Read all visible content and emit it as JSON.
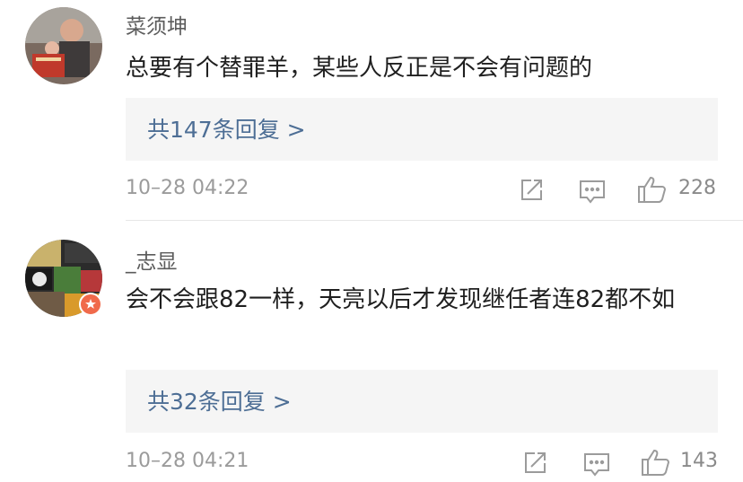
{
  "comments": [
    {
      "username": "菜须坤",
      "text": "总要有个替罪羊，某些人反正是不会有问题的",
      "reply_label": "共147条回复 >",
      "timestamp": "10–28 04:22",
      "likes": "228",
      "icons": [
        "share-icon",
        "comment-icon",
        "like-icon"
      ]
    },
    {
      "username": "_志显",
      "text": "会不会跟82一样，天亮以后才发现继任者连82都不如",
      "reply_label": "共32条回复 >",
      "timestamp": "10–28 04:21",
      "likes": "143",
      "icons": [
        "share-icon",
        "comment-icon",
        "like-icon"
      ],
      "verified_badge": true
    }
  ],
  "colors": {
    "link": "#4d6e95",
    "badge": "#f06a4b",
    "muted": "#9b9b9b"
  }
}
